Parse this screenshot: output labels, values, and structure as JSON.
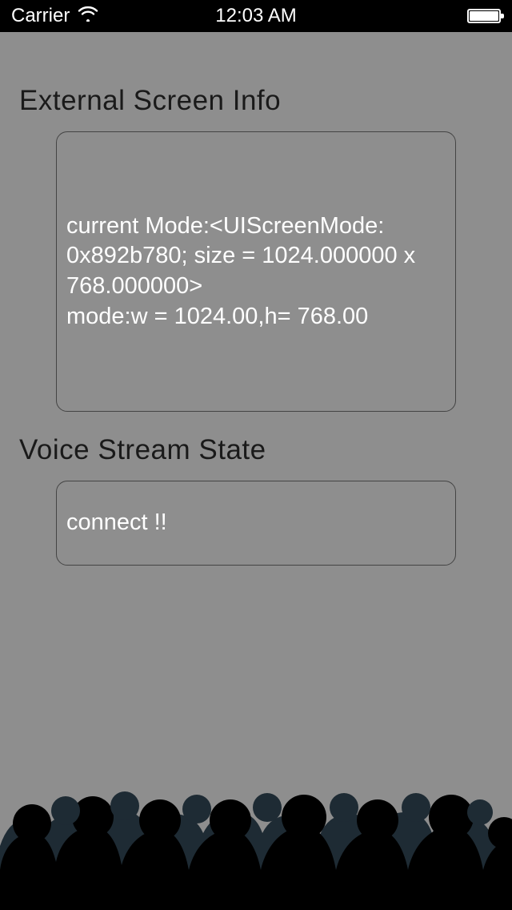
{
  "status_bar": {
    "carrier": "Carrier",
    "time": "12:03 AM"
  },
  "sections": {
    "external": {
      "title": "External Screen Info",
      "body": "current Mode:<UIScreenMode: 0x892b780; size = 1024.000000 x 768.000000>\nmode:w = 1024.00,h= 768.00"
    },
    "voice": {
      "title": "Voice Stream State",
      "body": "connect !!"
    }
  }
}
